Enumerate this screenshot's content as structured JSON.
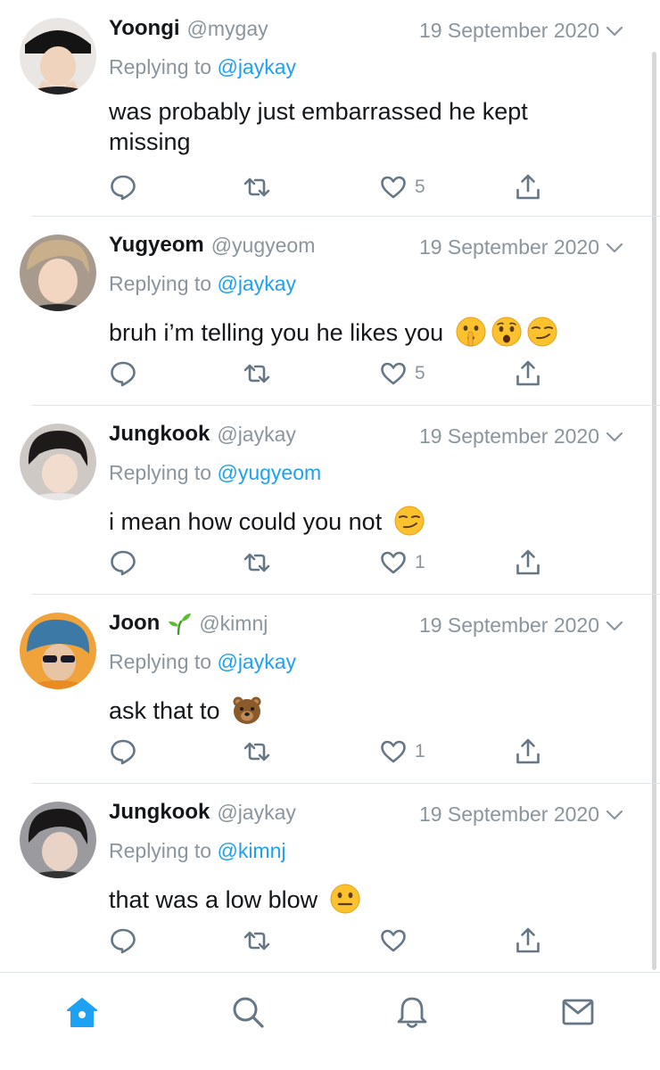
{
  "colors": {
    "accent": "#1da1f2",
    "secondary_text": "#8a959e",
    "icon_gray": "#657786"
  },
  "tweets": [
    {
      "name": "Yoongi",
      "name_icon": null,
      "handle": "@mygay",
      "date": "19 September 2020",
      "reply_prefix": "Replying to",
      "reply_to": "@jaykay",
      "text": "was probably just embarrassed he kept missing",
      "emojis": [],
      "likes": "5"
    },
    {
      "name": "Yugyeom",
      "name_icon": null,
      "handle": "@yugyeom",
      "date": "19 September 2020",
      "reply_prefix": "Replying to",
      "reply_to": "@jaykay",
      "text": "bruh i’m telling you he likes you",
      "emojis": [
        "shushing-face-emoji",
        "hushed-face-emoji",
        "smirking-face-emoji"
      ],
      "likes": "5"
    },
    {
      "name": "Jungkook",
      "name_icon": null,
      "handle": "@jaykay",
      "date": "19 September 2020",
      "reply_prefix": "Replying to",
      "reply_to": "@yugyeom",
      "text": "i mean how could you not",
      "emojis": [
        "smirking-face-emoji"
      ],
      "likes": "1"
    },
    {
      "name": "Joon",
      "name_icon": "seedling-emoji",
      "handle": "@kimnj",
      "date": "19 September 2020",
      "reply_prefix": "Replying to",
      "reply_to": "@jaykay",
      "text": "ask that to",
      "emojis": [
        "bear-face-emoji"
      ],
      "likes": "1"
    },
    {
      "name": "Jungkook",
      "name_icon": null,
      "handle": "@jaykay",
      "date": "19 September 2020",
      "reply_prefix": "Replying to",
      "reply_to": "@kimnj",
      "text": "that was a low blow",
      "emojis": [
        "neutral-face-emoji"
      ],
      "likes": ""
    }
  ],
  "tabbar": {
    "items": [
      "home-icon",
      "search-icon",
      "notifications-icon",
      "messages-icon"
    ],
    "active": "home-icon"
  }
}
